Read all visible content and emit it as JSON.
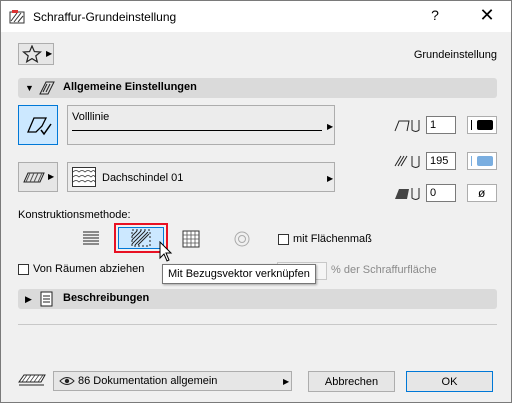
{
  "window": {
    "title": "Schraffur-Grundeinstellung",
    "help": "?",
    "close": "✕"
  },
  "header": {
    "preset_label": "Grundeinstellung"
  },
  "general": {
    "title": "Allgemeine Einstellungen",
    "line_type": "Volllinie",
    "fill_name": "Dachschindel 01",
    "pen1": "1",
    "pen2": "195",
    "pen3": "0",
    "construction_label": "Konstruktionsmethode:",
    "area_checkbox": "mit Flächenmaß",
    "rooms_checkbox": "Von Räumen abziehen",
    "tooltip": "Mit Bezugsvektor verknüpfen",
    "percent_suffix": "% der Schraffurfläche"
  },
  "description": {
    "title": "Beschreibungen"
  },
  "footer": {
    "layer_name": "86 Dokumentation allgemein",
    "cancel_label": "Abbrechen",
    "ok_label": "OK"
  },
  "colors": {
    "accent": "#0078d7",
    "highlight": "#e81123",
    "selected_bg": "#cce8ff",
    "fill_swatch": "#7aaee0"
  },
  "icons": [
    "hatch-app-icon",
    "star-icon",
    "hatch-tool-icon",
    "fill-pattern-icon",
    "pen-icon",
    "background-pen-icon",
    "cursor-arrow-icon"
  ]
}
